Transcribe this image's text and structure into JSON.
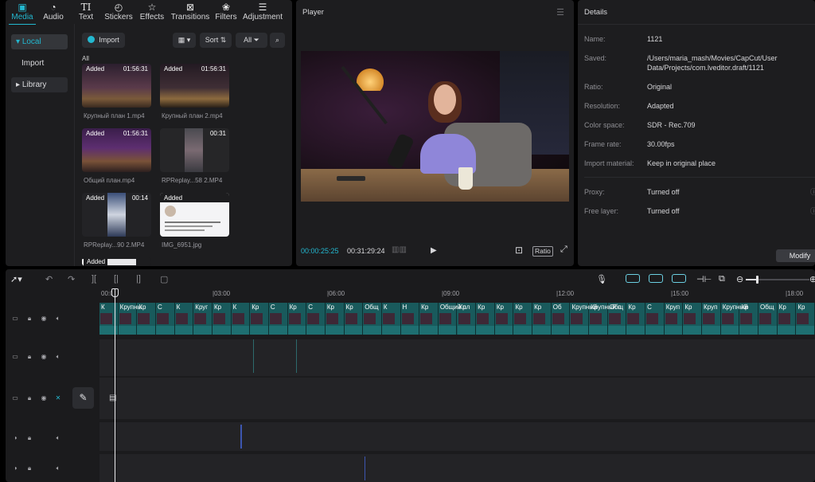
{
  "colors": {
    "accent": "#23b8d0",
    "panel": "#1d1d1f",
    "clip": "#195a5c"
  },
  "tabs": [
    {
      "label": "Media",
      "icon": "media-icon"
    },
    {
      "label": "Audio",
      "icon": "audio-icon"
    },
    {
      "label": "Text",
      "icon": "text-icon"
    },
    {
      "label": "Stickers",
      "icon": "stickers-icon"
    },
    {
      "label": "Effects",
      "icon": "effects-icon"
    },
    {
      "label": "Transitions",
      "icon": "transitions-icon"
    },
    {
      "label": "Filters",
      "icon": "filters-icon"
    },
    {
      "label": "Adjustment",
      "icon": "adjustment-icon"
    }
  ],
  "sidebar": {
    "local": "Local",
    "import": "Import",
    "library": "Library"
  },
  "media_toolbar": {
    "import": "Import",
    "sort": "Sort",
    "all": "All"
  },
  "all_label": "All",
  "media_items": [
    {
      "badge": "Added",
      "duration": "01:56:31",
      "name": "Крупный план 1.mp4"
    },
    {
      "badge": "Added",
      "duration": "01:56:31",
      "name": "Крупный план 2.mp4"
    },
    {
      "badge": "Added",
      "duration": "01:56:31",
      "name": "Общий план.mp4"
    },
    {
      "badge": "",
      "duration": "00:31",
      "name": "RPReplay...58 2.MP4"
    },
    {
      "badge": "Added",
      "duration": "00:14",
      "name": "RPReplay...90 2.MP4"
    },
    {
      "badge": "Added",
      "duration": "",
      "name": "IMG_6951.jpg"
    },
    {
      "badge": "Added",
      "duration": "",
      "name": ""
    }
  ],
  "player": {
    "title": "Player",
    "current_time": "00:00:25:25",
    "total_time": "00:31:29:24",
    "ratio": "Ratio"
  },
  "details": {
    "title": "Details",
    "rows": [
      {
        "key": "Name:",
        "value": "1121"
      },
      {
        "key": "Saved:",
        "value": "/Users/maria_mash/Movies/CapCut/User Data/Projects/com.lveditor.draft/1121"
      },
      {
        "key": "Ratio:",
        "value": "Original"
      },
      {
        "key": "Resolution:",
        "value": "Adapted"
      },
      {
        "key": "Color space:",
        "value": "SDR - Rec.709"
      },
      {
        "key": "Frame rate:",
        "value": "30.00fps"
      },
      {
        "key": "Import material:",
        "value": "Keep in original place"
      },
      {
        "key": "Proxy:",
        "value": "Turned off"
      },
      {
        "key": "Free layer:",
        "value": "Turned off"
      }
    ],
    "modify": "Modify"
  },
  "ruler": [
    "00:0",
    "|03:00",
    "|06:00",
    "|09:00",
    "|12:00",
    "|15:00",
    "|18:00"
  ],
  "clip_titles": [
    "К",
    "Крупны",
    "Кр",
    "С",
    "К",
    "Круг",
    "Кр",
    "К",
    "Кр",
    "С",
    "Кр",
    "С",
    "Кр",
    "Кр",
    "Общ",
    "К",
    "Н",
    "Кр",
    "Общий пл",
    "Кр",
    "Кр",
    "Кр",
    "Кр",
    "Кр",
    "Об",
    "Крупный",
    "Крупный п",
    "Общ",
    "Кр",
    "С",
    "Круп",
    "Кр",
    "Круп",
    "Крупный",
    "Кр",
    "Общ",
    "Кр",
    "Кр"
  ]
}
